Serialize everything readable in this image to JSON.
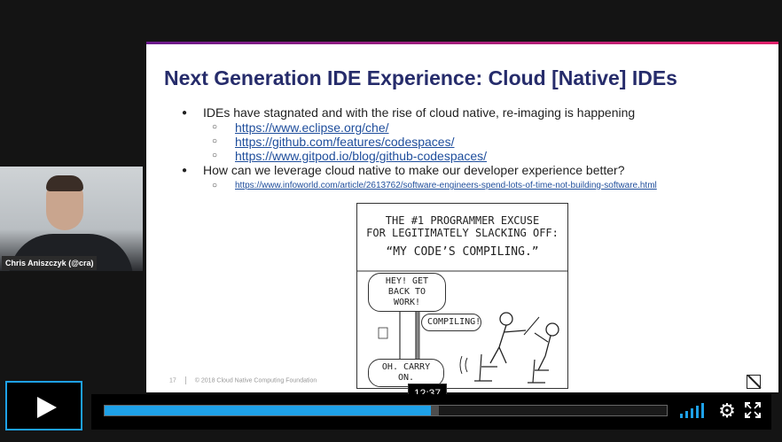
{
  "slide": {
    "title": "Next Generation IDE Experience: Cloud [Native] IDEs",
    "bullets": [
      {
        "text": "IDEs have stagnated and with the rise of cloud native, re-imaging is happening",
        "links": [
          "https://www.eclipse.org/che/",
          "https://github.com/features/codespaces/",
          "https://www.gitpod.io/blog/github-codespaces/"
        ]
      },
      {
        "text": "How can we leverage cloud native to make our developer experience better?",
        "links": [
          "https://www.infoworld.com/article/2613762/software-engineers-spend-lots-of-time-not-building-software.html"
        ]
      }
    ],
    "comic": {
      "line1": "THE #1 PROGRAMMER EXCUSE",
      "line2": "FOR LEGITIMATELY SLACKING OFF:",
      "line3": "“MY CODE’S COMPILING.”",
      "bubble_boss": "HEY! GET BACK TO WORK!",
      "bubble_worker": "COMPILING!",
      "bubble_boss_reply": "OH. CARRY ON."
    },
    "footer": {
      "page_number": "17",
      "copyright": "© 2018 Cloud Native Computing Foundation"
    }
  },
  "speaker": {
    "name": "Chris Aniszczyk (@cra)"
  },
  "player": {
    "current_time": "12:37",
    "played_fraction": 0.58,
    "loaded_fraction": 0.595,
    "accent_color": "#1ea1e8",
    "icons": [
      "play-icon",
      "volume-icon",
      "gear-icon",
      "fullscreen-icon",
      "expand-icon"
    ]
  }
}
